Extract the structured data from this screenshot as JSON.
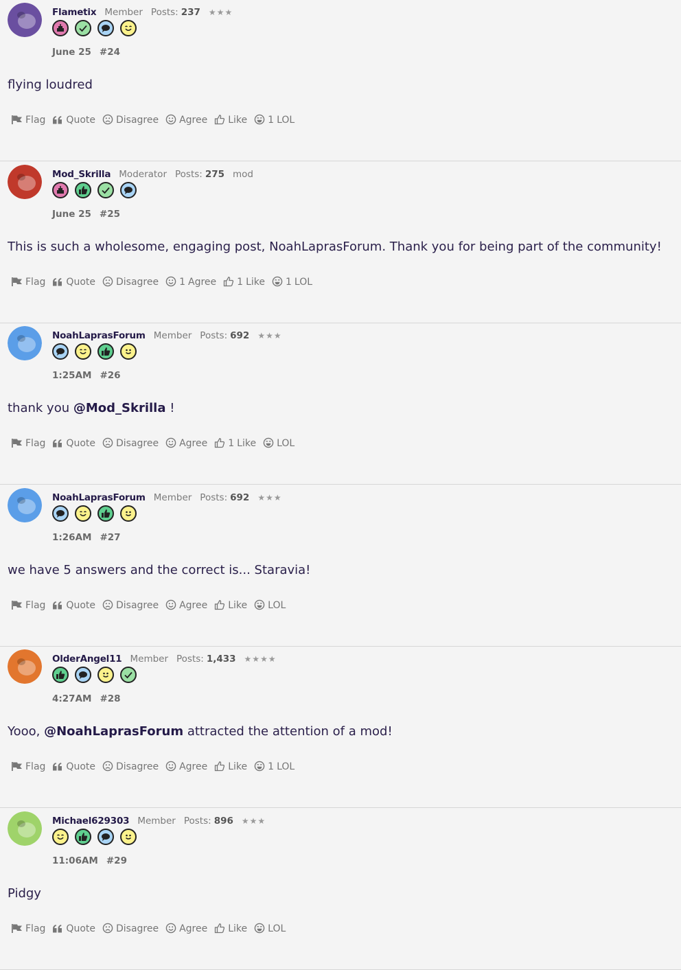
{
  "actions_labels": {
    "flag": "Flag",
    "quote": "Quote",
    "disagree": "Disagree",
    "agree": "Agree",
    "like": "Like",
    "lol": "LOL"
  },
  "posts": [
    {
      "username": "Flametix",
      "role": "Member",
      "posts_label": "Posts:",
      "posts_count": "237",
      "rank": "★★★",
      "extra_tag": "",
      "badges": [
        "cake",
        "check",
        "chat",
        "wink"
      ],
      "date": "June 25",
      "number": "#24",
      "text_before": "flying loudred",
      "mention": "",
      "text_after": "",
      "counts": {
        "disagree": "",
        "agree": "",
        "like": "",
        "lol": "1"
      },
      "avatar_color": "#6a4fa0"
    },
    {
      "username": "Mod_Skrilla",
      "role": "Moderator",
      "posts_label": "Posts:",
      "posts_count": "275",
      "rank": "",
      "extra_tag": "mod",
      "badges": [
        "cake",
        "thumb",
        "check",
        "chat"
      ],
      "date": "June 25",
      "number": "#25",
      "text_before": "This is such a wholesome, engaging post, NoahLaprasForum. Thank you for being part of the community!",
      "mention": "",
      "text_after": "",
      "counts": {
        "disagree": "",
        "agree": "1",
        "like": "1",
        "lol": "1"
      },
      "avatar_color": "#c0392b"
    },
    {
      "username": "NoahLaprasForum",
      "role": "Member",
      "posts_label": "Posts:",
      "posts_count": "692",
      "rank": "★★★",
      "extra_tag": "",
      "badges": [
        "chat",
        "wink",
        "thumb",
        "smile"
      ],
      "date": "1:25AM",
      "number": "#26",
      "text_before": "thank you ",
      "mention": "@Mod_Skrilla",
      "text_after": " !",
      "counts": {
        "disagree": "",
        "agree": "",
        "like": "1",
        "lol": ""
      },
      "avatar_color": "#5b9ee8"
    },
    {
      "username": "NoahLaprasForum",
      "role": "Member",
      "posts_label": "Posts:",
      "posts_count": "692",
      "rank": "★★★",
      "extra_tag": "",
      "badges": [
        "chat",
        "wink",
        "thumb",
        "smile"
      ],
      "date": "1:26AM",
      "number": "#27",
      "text_before": "we have 5 answers and the correct is... Staravia!",
      "mention": "",
      "text_after": "",
      "counts": {
        "disagree": "",
        "agree": "",
        "like": "",
        "lol": ""
      },
      "avatar_color": "#5b9ee8"
    },
    {
      "username": "OlderAngel11",
      "role": "Member",
      "posts_label": "Posts:",
      "posts_count": "1,433",
      "rank": "★★★★",
      "extra_tag": "",
      "badges": [
        "thumb",
        "chat",
        "smile",
        "check"
      ],
      "date": "4:27AM",
      "number": "#28",
      "text_before": "Yooo, ",
      "mention": "@NoahLaprasForum",
      "text_after": " attracted the attention of a mod!",
      "counts": {
        "disagree": "",
        "agree": "",
        "like": "",
        "lol": "1"
      },
      "avatar_color": "#e2762e"
    },
    {
      "username": "Michael629303",
      "role": "Member",
      "posts_label": "Posts:",
      "posts_count": "896",
      "rank": "★★★",
      "extra_tag": "",
      "badges": [
        "wink",
        "thumb",
        "chat",
        "smile"
      ],
      "date": "11:06AM",
      "number": "#29",
      "text_before": "Pidgy",
      "mention": "",
      "text_after": "",
      "counts": {
        "disagree": "",
        "agree": "",
        "like": "",
        "lol": ""
      },
      "avatar_color": "#9fd36a"
    }
  ]
}
